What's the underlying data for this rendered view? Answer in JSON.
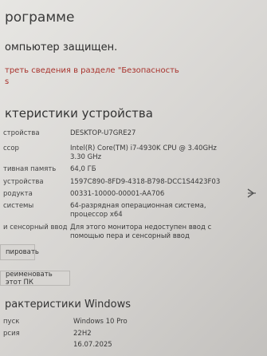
{
  "page": {
    "heading": "рограмме",
    "protected_text": "омпьютер защищен.",
    "security_link": [
      "треть сведения в разделе \"Безопасность",
      "s"
    ]
  },
  "device_specs": {
    "title": "ктеристики устройства",
    "rows": [
      {
        "label": "стройства",
        "value": [
          "DESKTOP-U7GRE27"
        ]
      },
      {
        "label": "ссор",
        "value": [
          "Intel(R) Core(TM) i7-4930K CPU @ 3.40GHz",
          "3.30 GHz"
        ]
      },
      {
        "label": "тивная память",
        "value": [
          "64,0 ГБ"
        ]
      },
      {
        "label": "устройства",
        "value": [
          "1597C890-8FD9-4318-B798-DCC1S4423F03"
        ]
      },
      {
        "label": "родукта",
        "value": [
          "00331-10000-00001-AA706"
        ]
      },
      {
        "label": "системы",
        "value": [
          "64-разрядная операционная система,",
          "процессор x64"
        ]
      },
      {
        "label": "и сенсорный ввод",
        "value": [
          "Для этого монитора недоступен ввод с",
          "помощью пера и сенсорный ввод"
        ]
      }
    ],
    "copy_button": "пировать",
    "rename_button": "реименовать этот ПК"
  },
  "windows_specs": {
    "title": "рактеристики Windows",
    "rows": [
      {
        "label": "пуск",
        "value": "Windows 10 Pro"
      },
      {
        "label": "рсия",
        "value": "22H2"
      },
      {
        "label": "",
        "value": "16.07.2025"
      }
    ]
  }
}
